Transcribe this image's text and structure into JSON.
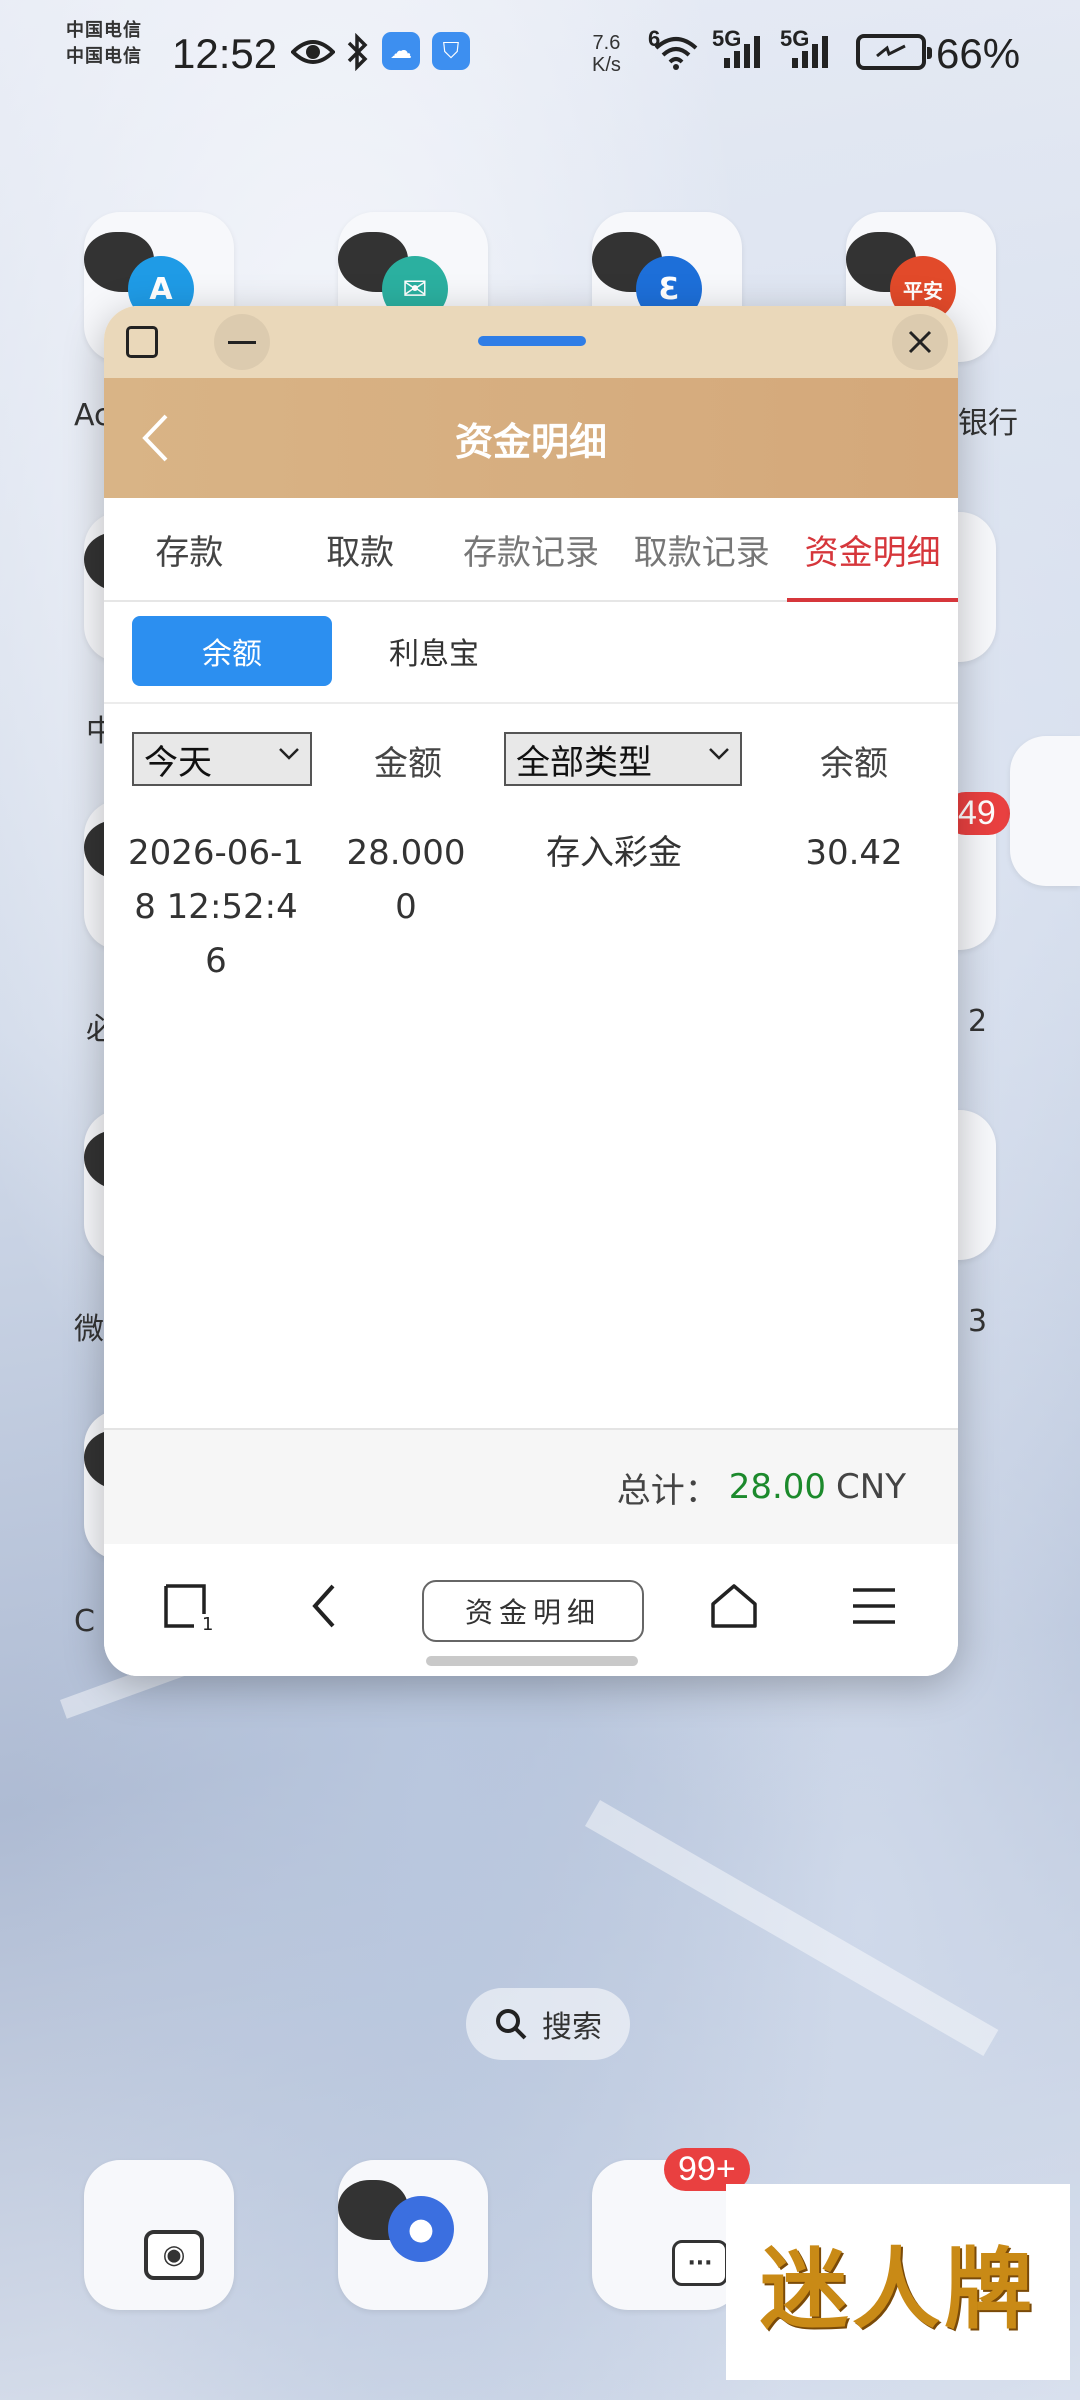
{
  "status_bar": {
    "carrier_1": "中国电信",
    "carrier_2": "中国电信",
    "time": "12:52",
    "net_speed_value": "7.6",
    "net_speed_unit": "K/s",
    "wifi_label": "6",
    "sim1_label": "5G",
    "sim2_label": "5G",
    "battery": "66%"
  },
  "home_screen": {
    "labels": {
      "left_1": "Ac",
      "right_1": "银行",
      "left_2": "中",
      "left_3": "必",
      "right_3": "2",
      "left_4": "微",
      "right_4": "3",
      "left_5": "C"
    },
    "badges": {
      "app_49": "49",
      "app_99": "99+"
    },
    "search_label": "搜索",
    "watermark": "迷人牌"
  },
  "window": {
    "header_title": "资金明细",
    "tabs": [
      {
        "label": "存款"
      },
      {
        "label": "取款"
      },
      {
        "label": "存款记录"
      },
      {
        "label": "取款记录"
      },
      {
        "label": "资金明细"
      }
    ],
    "subtabs": [
      {
        "label": "余额"
      },
      {
        "label": "利息宝"
      }
    ],
    "filters": {
      "date_select": "今天",
      "amount_header": "金额",
      "type_select": "全部类型",
      "balance_header": "余额"
    },
    "rows": [
      {
        "datetime": "2026-06-18 12:52:46",
        "amount": "28.0000",
        "type": "存入彩金",
        "balance": "30.42"
      }
    ],
    "total_label": "总计：",
    "total_amount": "28.00",
    "total_currency": "CNY",
    "browser": {
      "tab_count": "1",
      "page_title": "资金明细"
    }
  },
  "colors": {
    "header_gold": "#d9b486",
    "active_tab": "#d6363b",
    "subtab_blue": "#2c8ff0",
    "total_green": "#1c8a2c"
  }
}
